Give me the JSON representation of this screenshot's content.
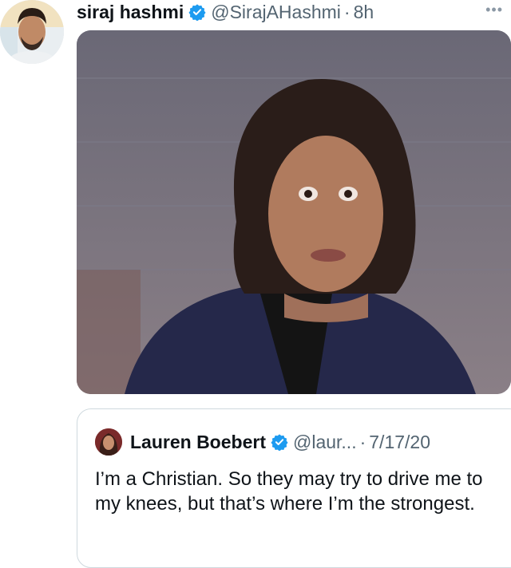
{
  "tweet": {
    "author_name": "siraj hashmi",
    "handle": "@SirajAHashmi",
    "separator": "·",
    "time": "8h",
    "more_label": "•••",
    "verified_color": "#1d9bf0"
  },
  "quoted_tweet": {
    "author_name": "Lauren Boebert",
    "handle": "@laur...",
    "separator": "·",
    "date": "7/17/20",
    "text": "I’m a Christian. So they may try to drive me to my knees, but that’s where I’m the strongest."
  }
}
